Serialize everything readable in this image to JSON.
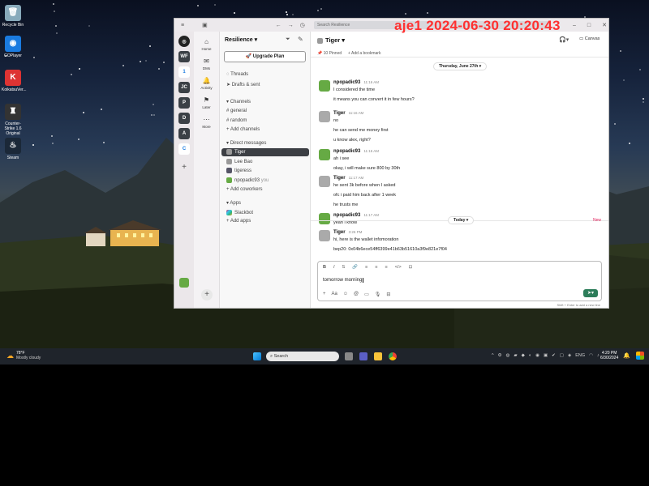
{
  "watermark": "aje1 2024-06-30 20:20:43",
  "desktop_icons": [
    {
      "label": "Recycle Bin",
      "glyph": "🗑",
      "color": "#8ab"
    },
    {
      "label": "GOPlayer",
      "glyph": "◉",
      "color": "#1a7be0"
    },
    {
      "label": "KoikatsuVer...",
      "glyph": "K",
      "color": "#d33"
    },
    {
      "label": "Counter-Strike 1.6 Original",
      "glyph": "♜",
      "color": "#333"
    },
    {
      "label": "Steam",
      "glyph": "♨",
      "color": "#1b2838"
    }
  ],
  "window": {
    "search_placeholder": "Search Resilience",
    "controls": [
      "–",
      "□",
      "✕"
    ]
  },
  "rail": {
    "workspaces": [
      "WF",
      "1",
      "JC",
      "P",
      "D",
      "A",
      "C"
    ],
    "add": "+"
  },
  "nav": {
    "items": [
      "Home",
      "DMs",
      "Activity",
      "Later",
      "More"
    ]
  },
  "sidebar": {
    "workspace": "Resilience",
    "upgrade": "Upgrade Plan",
    "threads": "Threads",
    "drafts": "Drafts & sent",
    "channels_header": "Channels",
    "channels": [
      "general",
      "random"
    ],
    "add_channels": "Add channels",
    "dm_header": "Direct messages",
    "dms": [
      {
        "name": "Tiger",
        "color": "#777"
      },
      {
        "name": "Lee Bao",
        "color": "#999"
      },
      {
        "name": "tigeress",
        "color": "#556"
      },
      {
        "name": "npopadic93",
        "color": "#6a4",
        "suffix": "you"
      }
    ],
    "add_coworkers": "Add coworkers",
    "apps_header": "Apps",
    "apps": [
      "Slackbot"
    ],
    "add_apps": "Add apps"
  },
  "channel": {
    "name": "Tiger",
    "pinned": "10 Pinned",
    "bookmark": "Add a bookmark",
    "huddle": "⌂",
    "canvas": "Canvas",
    "date_old": "Thursday, June 27th",
    "date_today": "Today",
    "new_label": "New"
  },
  "messages": [
    {
      "author": "npopadic93",
      "time": "11:16 AM",
      "avatar": "#6a4",
      "lines": [
        "I considered the time",
        "it means you can convert it in few hours?"
      ]
    },
    {
      "author": "Tiger",
      "time": "11:16 AM",
      "avatar": "#aaa",
      "lines": [
        "no",
        "he can send me money first",
        "u know alex, right?"
      ]
    },
    {
      "author": "npopadic93",
      "time": "11:16 AM",
      "avatar": "#6a4",
      "lines": [
        "ah i see",
        "okay, i will make sure 800 by 30th"
      ]
    },
    {
      "author": "Tiger",
      "time": "11:17 AM",
      "avatar": "#aaa",
      "lines": [
        "he sent 3k before when I asked",
        "ofc i paid him back after 1 week",
        "he trusts me"
      ]
    },
    {
      "author": "npopadic93",
      "time": "11:17 AM",
      "avatar": "#6a4",
      "lines": [
        "yeah i know"
      ]
    }
  ],
  "today_message": {
    "author": "Tiger",
    "time": "3:26 PM",
    "avatar": "#aaa",
    "lines": [
      "hi, here is the wallet infomoration",
      "bep20: 0x04b6ece54ff6399e41b63b51610a3f9e821e7f04"
    ]
  },
  "composer": {
    "text": "tomorrow morning",
    "hint": "Shift + Enter to add a new line",
    "toolbar": [
      "B",
      "I",
      "S",
      "🔗",
      "≡",
      "≡",
      "≡",
      "</>",
      "⊡"
    ]
  },
  "taskbar": {
    "weather_temp": "78°F",
    "weather_desc": "Mostly cloudy",
    "search": "Search",
    "lang": "ENG",
    "time": "4:20 PM",
    "date": "6/30/2024"
  }
}
